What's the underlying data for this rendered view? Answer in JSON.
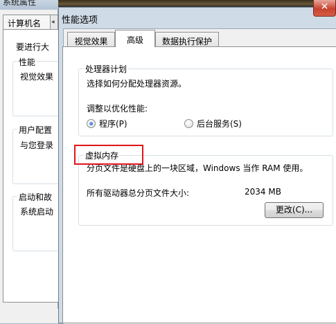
{
  "background_window": {
    "title": "系统属性",
    "tab_label": "计算机名",
    "tab_arrow": "◂",
    "intro_text": "要进行大",
    "performance_label": "性能",
    "performance_text": "视觉效果",
    "user_profile_label": "用户配置",
    "user_profile_text": "与您登录",
    "startup_label": "启动和故",
    "startup_text": "系统启动"
  },
  "dialog": {
    "title": "性能选项",
    "close_glyph": "✕",
    "tabs": [
      {
        "label": "视觉效果",
        "active": false
      },
      {
        "label": "高级",
        "active": true
      },
      {
        "label": "数据执行保护",
        "active": false
      }
    ],
    "processor_scheduling": {
      "label": "处理器计划",
      "description": "选择如何分配处理器资源。",
      "adjust_label": "调整以优化性能:",
      "options": [
        {
          "label": "程序(P)",
          "selected": true
        },
        {
          "label": "后台服务(S)",
          "selected": false
        }
      ]
    },
    "virtual_memory": {
      "label": "虚拟内存",
      "description": "分页文件是硬盘上的一块区域，Windows 当作 RAM 使用。",
      "total_label": "所有驱动器总分页文件大小:",
      "total_value": "2034 MB",
      "change_button": "更改(C)..."
    }
  },
  "colors": {
    "highlight": "#e0141b",
    "radio_selected": "#1c4fb2",
    "dialog_chrome": "#cfdbe7"
  }
}
